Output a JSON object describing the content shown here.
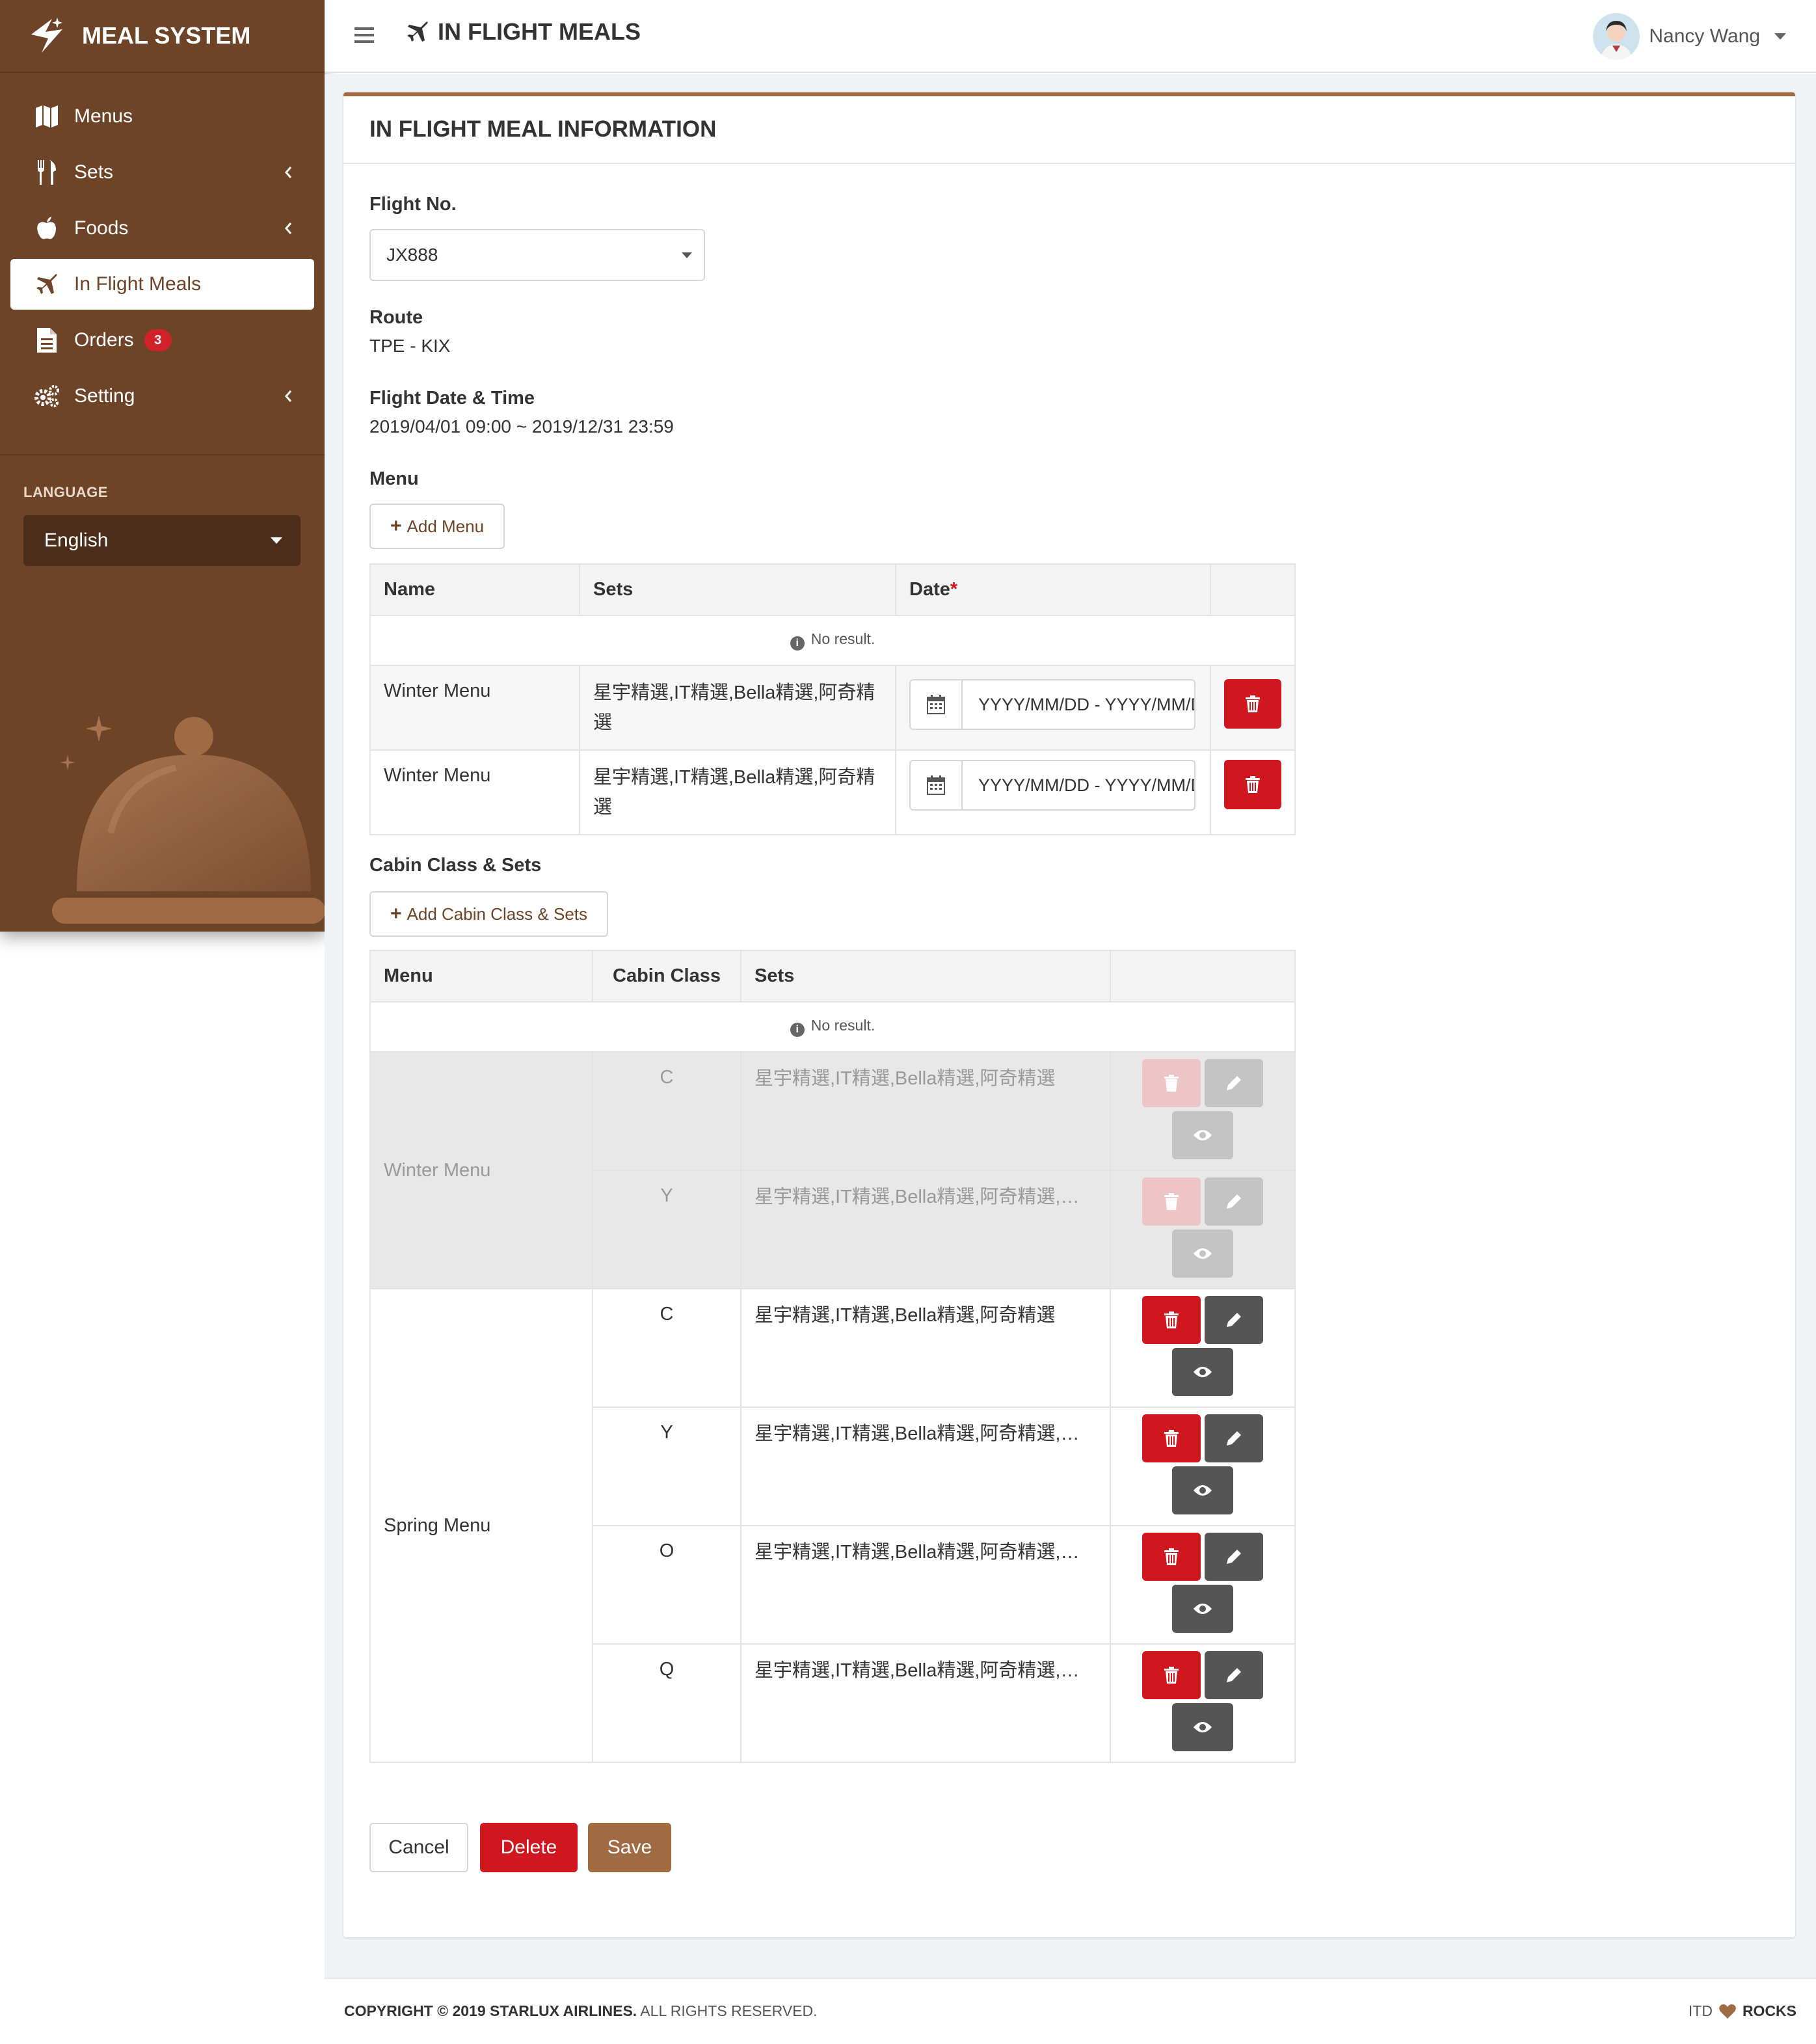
{
  "brand": {
    "name": "MEAL SYSTEM"
  },
  "sidebar": {
    "items": [
      {
        "label": "Menus",
        "icon": "map-icon"
      },
      {
        "label": "Sets",
        "icon": "utensils-icon"
      },
      {
        "label": "Foods",
        "icon": "apple-icon"
      },
      {
        "label": "In Flight Meals",
        "icon": "plane-icon"
      },
      {
        "label": "Orders",
        "icon": "document-icon",
        "badge": "3"
      },
      {
        "label": "Setting",
        "icon": "gears-icon"
      }
    ],
    "language_title": "LANGUAGE",
    "language_value": "English"
  },
  "topbar": {
    "title": "IN FLIGHT MEALS",
    "user_name": "Nancy Wang"
  },
  "card": {
    "title": "IN FLIGHT MEAL INFORMATION",
    "flight_no_label": "Flight No.",
    "flight_no_value": "JX888",
    "route_label": "Route",
    "route_value": "TPE - KIX",
    "date_label": "Flight Date & Time",
    "date_value": "2019/04/01 09:00 ~ 2019/12/31 23:59",
    "menu_label": "Menu",
    "add_menu": "Add Menu",
    "cabin_label": "Cabin Class & Sets",
    "add_cabin": "Add Cabin Class & Sets"
  },
  "menu_table": {
    "headers": {
      "name": "Name",
      "sets": "Sets",
      "date": "Date",
      "required": "*"
    },
    "no_result": "No result.",
    "rows": [
      {
        "name": "Winter Menu",
        "sets": "星宇精選,IT精選,Bella精選,阿奇精選",
        "date_placeholder": "YYYY/MM/DD - YYYY/MM/DD"
      },
      {
        "name": "Winter Menu",
        "sets": "星宇精選,IT精選,Bella精選,阿奇精選",
        "date_placeholder": "YYYY/MM/DD - YYYY/MM/DD"
      }
    ]
  },
  "cabin_table": {
    "headers": {
      "menu": "Menu",
      "cabin": "Cabin Class",
      "sets": "Sets"
    },
    "no_result": "No result.",
    "groups": [
      {
        "menu": "Winter Menu",
        "disabled": true,
        "rows": [
          {
            "cabin": "C",
            "sets": "星宇精選,IT精選,Bella精選,阿奇精選"
          },
          {
            "cabin": "Y",
            "sets": "星宇精選,IT精選,Bella精選,阿奇精選,阿奇精選"
          }
        ]
      },
      {
        "menu": "Spring Menu",
        "disabled": false,
        "rows": [
          {
            "cabin": "C",
            "sets": "星宇精選,IT精選,Bella精選,阿奇精選"
          },
          {
            "cabin": "Y",
            "sets": "星宇精選,IT精選,Bella精選,阿奇精選,阿奇精選"
          },
          {
            "cabin": "O",
            "sets": "星宇精選,IT精選,Bella精選,阿奇精選,阿奇精選"
          },
          {
            "cabin": "Q",
            "sets": "星宇精選,IT精選,Bella精選,阿奇精選,阿奇精選"
          }
        ]
      }
    ]
  },
  "actions": {
    "cancel": "Cancel",
    "delete": "Delete",
    "save": "Save"
  },
  "footer": {
    "copyright_prefix": "COPYRIGHT © 2019 STARLUX AIRLINES.",
    "copyright_suffix": " ALL RIGHTS RESERVED.",
    "right_prefix": "ITD",
    "right_suffix": "ROCKS"
  },
  "colors": {
    "sidebar": "#6e4428",
    "accent": "#a06a42",
    "danger": "#d0161f",
    "dark_button": "#555555"
  }
}
